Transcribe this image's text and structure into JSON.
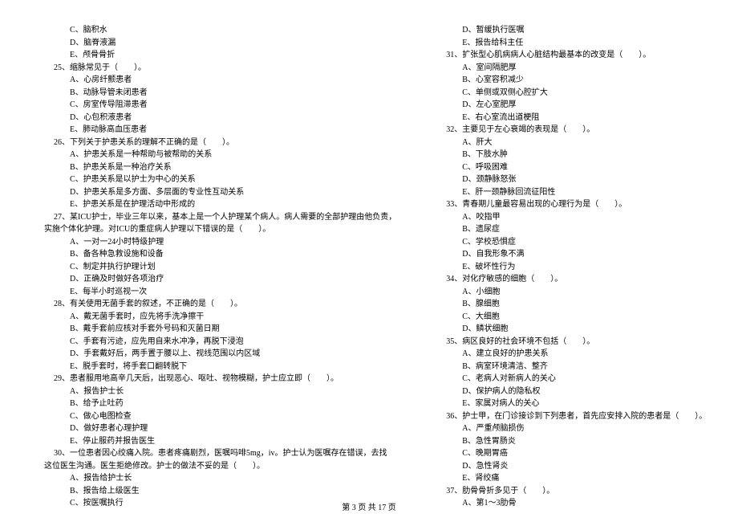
{
  "left": {
    "pre_opts": [
      "C、脑积水",
      "D、脑脊液漏",
      "E、颅骨骨折"
    ],
    "q25": {
      "stem": "25、缩脉常见于（　　）。",
      "opts": [
        "A、心房纤颤患者",
        "B、动脉导管未闭患者",
        "C、房室传导阻滞患者",
        "D、心包积液患者",
        "E、肺动脉高血压患者"
      ]
    },
    "q26": {
      "stem": "26、下列关于护患关系的理解不正确的是（　　）。",
      "opts": [
        "A、护患关系是一种帮助与被帮助的关系",
        "B、护患关系是一种治疗关系",
        "C、护患关系是以护士为中心的关系",
        "D、护患关系是多方面、多层面的专业性互动关系",
        "E、护患关系是在护理活动中形成的"
      ]
    },
    "q27": {
      "stem": "27、某ICU护士，毕业三年以来，基本上是一个人护理某个病人。病人需要的全部护理由他负责，",
      "stem2": "实施个体化护理。对ICU的重症病人护理以下错误的是（　　）。",
      "opts": [
        "A、一对一24小时特级护理",
        "B、备各种急救设施和设备",
        "C、制定并执行护理计划",
        "D、正确及时做好各项治疗",
        "E、每半小时巡视一次"
      ]
    },
    "q28": {
      "stem": "28、有关使用无菌手套的叙述，不正确的是（　　）。",
      "opts": [
        "A、戴无菌手套时，应先将手洗净擦干",
        "B、戴手套前应核对手套外号码和灭菌日期",
        "C、手套有污迹，应先用自来水冲净，再脱下浸泡",
        "D、手套戴好后，两手置于腰以上、视线范围以内区域",
        "E、脱手套时，将手套口翻转脱下"
      ]
    },
    "q29": {
      "stem": "29、患者服用地高辛几天后，出现恶心、呕吐、视物模糊，护士应立即（　　）。",
      "opts": [
        "A、报告护士长",
        "B、给予止吐药",
        "C、做心电图检查",
        "D、做好患者心理护理",
        "E、停止服药并报告医生"
      ]
    },
    "q30": {
      "stem": "30、一位患者因心绞痛入院。患者疼痛剧烈，医嘱吗啡5mg，iv。护士认为医嘱存在错误，去找",
      "stem2": "这位医生沟通。医生拒绝修改。护士的做法不妥的是（　　）。",
      "opts": [
        "A、报告给护士长",
        "B、报告给上级医生",
        "C、按医嘱执行"
      ]
    }
  },
  "right": {
    "pre_opts": [
      "D、暂缓执行医嘱",
      "E、报告给科主任"
    ],
    "q31": {
      "stem": "31、扩张型心肌病病人心脏结构最基本的改变是（　　）。",
      "opts": [
        "A、室间隔肥厚",
        "B、心室容积减少",
        "C、单侧或双侧心腔扩大",
        "D、左心室肥厚",
        "E、右心室流出道梗阻"
      ]
    },
    "q32": {
      "stem": "32、主要见于左心衰竭的表现是（　　）。",
      "opts": [
        "A、肝大",
        "B、下肢水肿",
        "C、呼吸困难",
        "D、颈静脉怒张",
        "E、肝一颈静脉回流征阳性"
      ]
    },
    "q33": {
      "stem": "33、青春期儿童最容易出现的心理行为是（　　）。",
      "opts": [
        "A、咬指甲",
        "B、遗尿症",
        "C、学校恐惧症",
        "D、自我形象不满",
        "E、破坏性行为"
      ]
    },
    "q34": {
      "stem": "34、对化疗敏感的细胞（　　）。",
      "opts": [
        "A、小细胞",
        "B、腺细胞",
        "C、大细胞",
        "D、鳞状细胞"
      ]
    },
    "q35": {
      "stem": "35、病区良好的社会环境不包括（　　）。",
      "opts": [
        "A、建立良好的护患关系",
        "B、病室环境清洁、整齐",
        "C、老病人对新病人的关心",
        "D、保护病人的隐私权",
        "E、家属对病人的关心"
      ]
    },
    "q36": {
      "stem": "36、护士甲，在门诊接诊到下列患者，首先应安排入院的患者是（　　）。",
      "opts": [
        "A、严重颅脑损伤",
        "B、急性胃肠炎",
        "C、晚期胃癌",
        "D、急性肾炎",
        "E、肾绞痛"
      ]
    },
    "q37": {
      "stem": "37、肋骨骨折多见于（　　）。",
      "opts": [
        "A、第1～3肋骨"
      ]
    }
  },
  "footer": "第 3 页 共 17 页"
}
